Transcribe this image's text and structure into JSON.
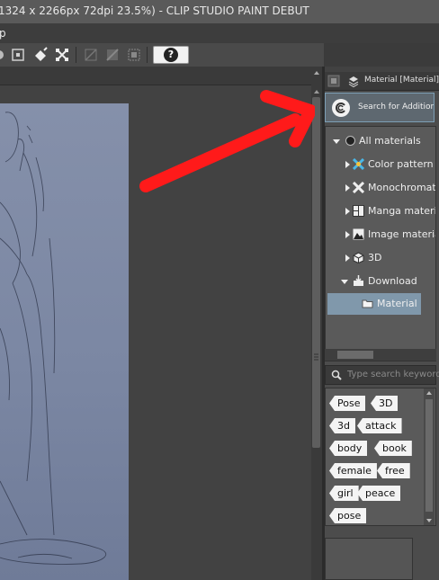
{
  "window": {
    "title": "1324 x 2266px 72dpi 23.5%)  - CLIP STUDIO PAINT DEBUT"
  },
  "menu": {
    "visible_item": "p"
  },
  "toolbar": {
    "help_label": "?"
  },
  "panel": {
    "tab_title": "Material [Material]",
    "search_additional_label": "Search for Additional M",
    "tree": [
      {
        "label": "All materials",
        "icon": "all-materials-icon",
        "state": "expanded"
      },
      {
        "label": "Color pattern",
        "icon": "color-pattern-icon",
        "state": "collapsed"
      },
      {
        "label": "Monochromat",
        "icon": "monochromatic-icon",
        "state": "collapsed"
      },
      {
        "label": "Manga materi",
        "icon": "manga-material-icon",
        "state": "collapsed"
      },
      {
        "label": "Image materia",
        "icon": "image-material-icon",
        "state": "collapsed"
      },
      {
        "label": "3D",
        "icon": "3d-icon",
        "state": "collapsed"
      },
      {
        "label": "Download",
        "icon": "download-icon",
        "state": "expanded"
      },
      {
        "label": "Material",
        "icon": "folder-icon",
        "state": "selected"
      }
    ],
    "search_placeholder": "Type search keywords",
    "tags": [
      "Pose",
      "3D",
      "3d",
      "attack",
      "body",
      "book",
      "female",
      "free",
      "girl",
      "peace",
      "pose"
    ]
  },
  "annotation": {
    "arrow_color": "#ff0000"
  }
}
